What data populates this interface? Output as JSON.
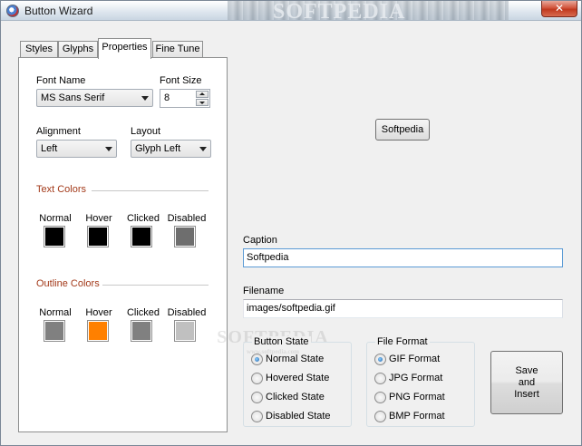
{
  "window": {
    "title": "Button Wizard",
    "close_glyph": "✕",
    "watermark": "SOFTPEDIA"
  },
  "tabs": [
    {
      "label": "Styles"
    },
    {
      "label": "Glyphs"
    },
    {
      "label": "Properties"
    },
    {
      "label": "Fine Tune"
    }
  ],
  "properties": {
    "font_name_label": "Font Name",
    "font_name_value": "MS Sans Serif",
    "font_size_label": "Font Size",
    "font_size_value": "8",
    "alignment_label": "Alignment",
    "alignment_value": "Left",
    "layout_label": "Layout",
    "layout_value": "Glyph Left",
    "text_colors": {
      "title": "Text Colors",
      "items": [
        {
          "label": "Normal",
          "color": "#000000"
        },
        {
          "label": "Hover",
          "color": "#000000"
        },
        {
          "label": "Clicked",
          "color": "#000000"
        },
        {
          "label": "Disabled",
          "color": "#6e6e6e"
        }
      ]
    },
    "outline_colors": {
      "title": "Outline Colors",
      "items": [
        {
          "label": "Normal",
          "color": "#808080"
        },
        {
          "label": "Hover",
          "color": "#ff8000"
        },
        {
          "label": "Clicked",
          "color": "#808080"
        },
        {
          "label": "Disabled",
          "color": "#c0c0c0"
        }
      ]
    }
  },
  "preview": {
    "button_label": "Softpedia"
  },
  "caption": {
    "label": "Caption",
    "value": "Softpedia"
  },
  "filename": {
    "label": "Filename",
    "value": "images/softpedia.gif"
  },
  "button_state": {
    "title": "Button State",
    "options": [
      {
        "label": "Normal State",
        "selected": true
      },
      {
        "label": "Hovered State",
        "selected": false
      },
      {
        "label": "Clicked State",
        "selected": false
      },
      {
        "label": "Disabled State",
        "selected": false
      }
    ]
  },
  "file_format": {
    "title": "File Format",
    "options": [
      {
        "label": "GIF Format",
        "selected": true
      },
      {
        "label": "JPG Format",
        "selected": false
      },
      {
        "label": "PNG Format",
        "selected": false
      },
      {
        "label": "BMP Format",
        "selected": false
      }
    ]
  },
  "save_button": {
    "label": "Save\nand\nInsert"
  },
  "watermark_center": {
    "text": "SOFTPEDIA",
    "sub": "www.softpedia.com"
  }
}
